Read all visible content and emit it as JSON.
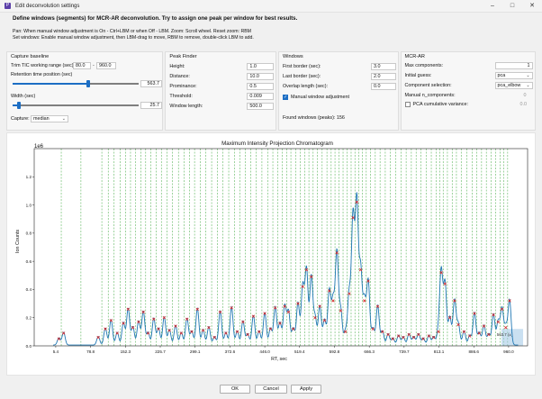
{
  "window": {
    "title": "Edit deconvolution settings",
    "minimize_icon": "minimize-icon",
    "maximize_icon": "maximize-icon",
    "close_icon": "close-icon"
  },
  "header": {
    "heading": "Define windows (segments) for MCR-AR deconvolution. Try to assign one peak per window for best results.",
    "pan_text": "Pan: When manual window adjustment is On - Ctrl+LBM or when Off - LBM. Zoom: Scroll wheel. Reset zoom: RBM",
    "windows_text": "Set windows: Enable manual window adjustment, then LBM-drag to move, RBM to remove, double-click LBM to add."
  },
  "capture_baseline": {
    "title": "Capture baseline",
    "trim_label": "Trim TIC working range (sec):",
    "trim_from": "80.0",
    "trim_dash": "-",
    "trim_to": "960.0",
    "rt_label": "Retention time position (sec)",
    "rt_value": "563.7",
    "rt_fraction": 0.6,
    "width_label": "Width (sec)",
    "width_value": "25.7",
    "width_fraction": 0.05,
    "capture_label": "Capture:",
    "capture_value": "median"
  },
  "peak_finder": {
    "title": "Peak Finder",
    "height_label": "Height:",
    "height_value": "1.0",
    "distance_label": "Distance:",
    "distance_value": "10.0",
    "prominence_label": "Prominance:",
    "prominence_value": "0.5",
    "threshold_label": "Threshold:",
    "threshold_value": "0.009",
    "window_length_label": "Window length:",
    "window_length_value": "500.0"
  },
  "windows": {
    "title": "Windows",
    "first_border_label": "First border (sec):",
    "first_border_value": "3.0",
    "last_border_label": "Last border (sec):",
    "last_border_value": "2.0",
    "overlap_label": "Overlap length (sec):",
    "overlap_value": "0.0",
    "manual_label": "Manual window adjustment",
    "manual_checked": true,
    "found_text": "Found windows (peaks): 156"
  },
  "mcr_ar": {
    "title": "MCR-AR",
    "max_components_label": "Max components:",
    "max_components_value": "1",
    "initial_guess_label": "Initial guess:",
    "initial_guess_value": "pca",
    "component_selection_label": "Component selection:",
    "component_selection_value": "pca_elbow",
    "manual_n_label": "Manual n_components:",
    "manual_n_value": "0",
    "pca_variance_label": "PCA cumulative variance:",
    "pca_variance_value": "0.0",
    "pca_variance_checked": false
  },
  "chart_data": {
    "type": "line",
    "title": "Maximum Intensity Projection Chromatogram",
    "xlabel": "RT, sec",
    "ylabel": "Ion Counts",
    "y_multiplier": "1e6",
    "xlim": [
      -40,
      1000
    ],
    "ylim": [
      0,
      1.4
    ],
    "x_ticks": [
      "5.4",
      "78.8",
      "152.3",
      "225.7",
      "299.1",
      "372.6",
      "446.0",
      "519.4",
      "592.8",
      "666.3",
      "739.7",
      "813.1",
      "886.6",
      "960.0"
    ],
    "y_ticks": [
      "0.0",
      "0.2",
      "0.4",
      "0.6",
      "0.8",
      "1.0",
      "1.2"
    ],
    "grid": false,
    "baseline_label": "563.7 (±)",
    "peaks": [
      [
        12,
        0.05
      ],
      [
        22,
        0.09
      ],
      [
        95,
        0.06
      ],
      [
        110,
        0.12
      ],
      [
        122,
        0.18
      ],
      [
        135,
        0.09
      ],
      [
        148,
        0.16
      ],
      [
        158,
        0.26
      ],
      [
        168,
        0.13
      ],
      [
        180,
        0.17
      ],
      [
        190,
        0.24
      ],
      [
        200,
        0.09
      ],
      [
        212,
        0.19
      ],
      [
        222,
        0.12
      ],
      [
        234,
        0.2
      ],
      [
        245,
        0.11
      ],
      [
        258,
        0.14
      ],
      [
        270,
        0.09
      ],
      [
        282,
        0.19
      ],
      [
        292,
        0.1
      ],
      [
        304,
        0.26
      ],
      [
        316,
        0.11
      ],
      [
        328,
        0.13
      ],
      [
        340,
        0.06
      ],
      [
        352,
        0.24
      ],
      [
        364,
        0.09
      ],
      [
        376,
        0.27
      ],
      [
        388,
        0.1
      ],
      [
        400,
        0.17
      ],
      [
        410,
        0.08
      ],
      [
        422,
        0.21
      ],
      [
        434,
        0.1
      ],
      [
        446,
        0.23
      ],
      [
        458,
        0.12
      ],
      [
        468,
        0.27
      ],
      [
        478,
        0.16
      ],
      [
        488,
        0.28
      ],
      [
        496,
        0.24
      ],
      [
        506,
        0.12
      ],
      [
        516,
        0.3
      ],
      [
        526,
        0.42
      ],
      [
        534,
        0.54
      ],
      [
        544,
        0.49
      ],
      [
        552,
        0.2
      ],
      [
        562,
        0.28
      ],
      [
        572,
        0.18
      ],
      [
        582,
        0.39
      ],
      [
        590,
        0.32
      ],
      [
        598,
        0.66
      ],
      [
        606,
        0.25
      ],
      [
        616,
        0.1
      ],
      [
        624,
        0.37
      ],
      [
        632,
        0.91
      ],
      [
        640,
        1.02
      ],
      [
        648,
        0.54
      ],
      [
        656,
        0.32
      ],
      [
        664,
        0.46
      ],
      [
        674,
        0.12
      ],
      [
        684,
        0.28
      ],
      [
        694,
        0.1
      ],
      [
        706,
        0.08
      ],
      [
        716,
        0.05
      ],
      [
        728,
        0.07
      ],
      [
        738,
        0.06
      ],
      [
        750,
        0.08
      ],
      [
        760,
        0.06
      ],
      [
        770,
        0.08
      ],
      [
        780,
        0.05
      ],
      [
        792,
        0.07
      ],
      [
        802,
        0.06
      ],
      [
        812,
        0.1
      ],
      [
        818,
        0.52
      ],
      [
        826,
        0.44
      ],
      [
        836,
        0.2
      ],
      [
        846,
        0.32
      ],
      [
        854,
        0.15
      ],
      [
        866,
        0.1
      ],
      [
        878,
        0.07
      ],
      [
        888,
        0.23
      ],
      [
        898,
        0.09
      ],
      [
        908,
        0.14
      ],
      [
        918,
        0.08
      ],
      [
        928,
        0.22
      ],
      [
        938,
        0.17
      ],
      [
        946,
        0.26
      ],
      [
        954,
        0.13
      ],
      [
        962,
        0.32
      ]
    ]
  },
  "footer": {
    "ok_label": "OK",
    "cancel_label": "Cancel",
    "apply_label": "Apply"
  }
}
